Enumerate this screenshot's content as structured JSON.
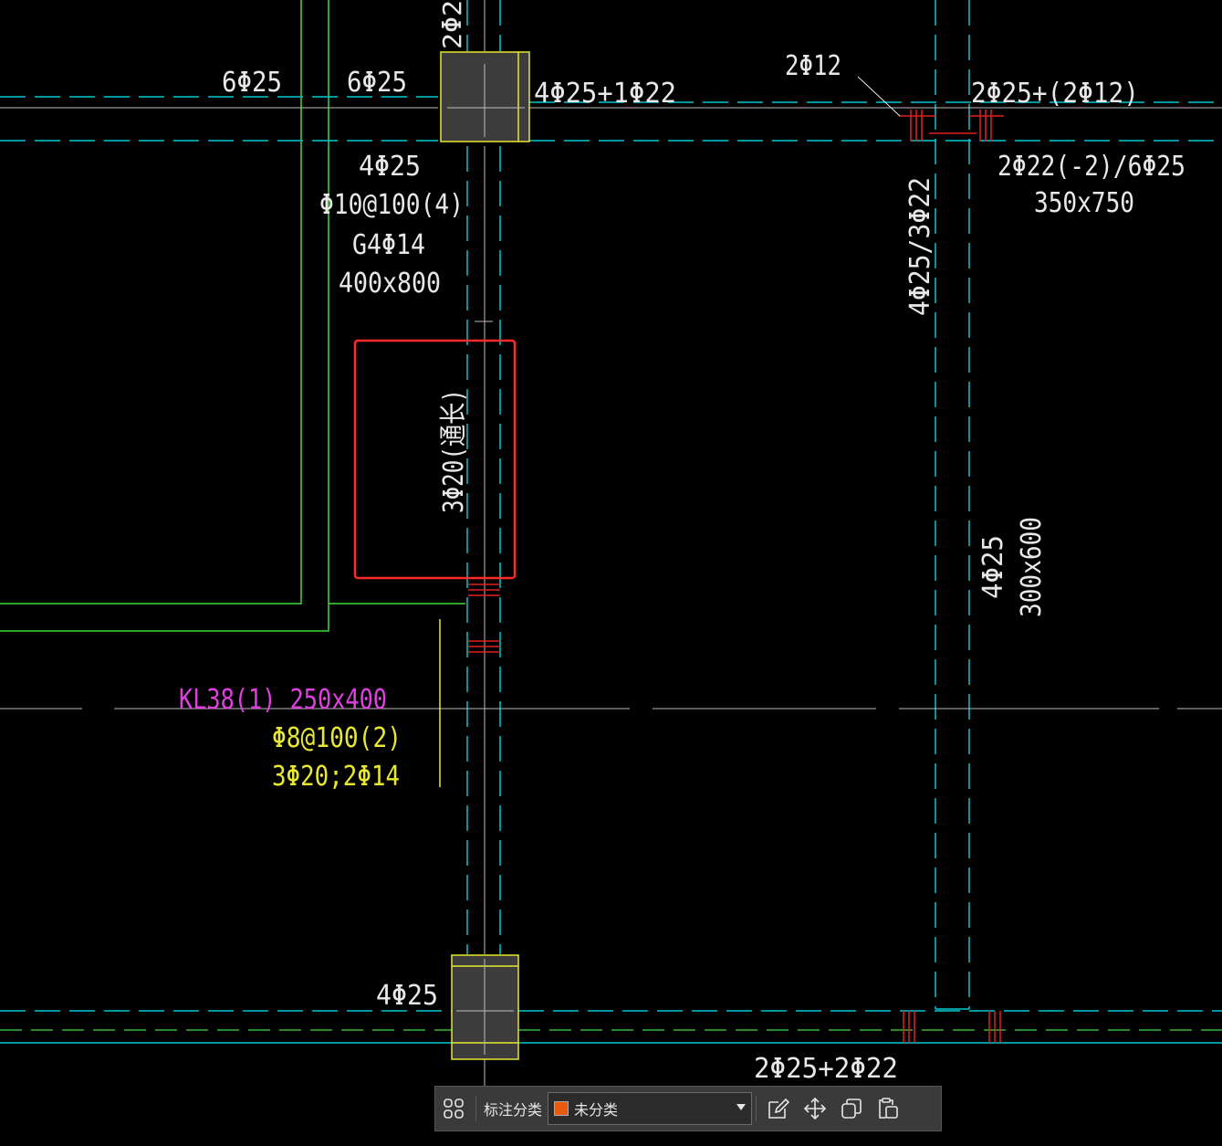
{
  "colors": {
    "axis_cyan": "#00c8d2",
    "wall_green": "#3cdc3c",
    "text_white": "#e8e8e8",
    "beam_magenta": "#e040e0",
    "beam_yellow": "#e8e830",
    "column_fill": "#3c3c3c",
    "column_border": "#e8e830",
    "rebar_red": "#e02020",
    "highlight_red": "#ff2a2a",
    "category_orange": "#e85a10"
  },
  "annotations": {
    "top_cut": "2Φ2",
    "left_6d25": "6Φ25",
    "mid_6d25": "6Φ25",
    "col_top_right": "4Φ25+1Φ22",
    "col_top_below": "4Φ25",
    "stirrup": "Φ10@100(4)",
    "g4": "G4Φ14",
    "section_400": "400x800",
    "tag_2d12": "2Φ12",
    "right_top": "2Φ25+(2Φ12)",
    "right_mid": "2Φ22(-2)/6Φ25",
    "section_350": "350x750",
    "vertical_4d25_3d22": "4Φ25/3Φ22",
    "vertical_tonchang": "3Φ20(通长)",
    "vertical_4d25": "4Φ25",
    "vertical_300x600": "300x600",
    "col_bottom": "4Φ25",
    "bottom_right": "2Φ25+2Φ22"
  },
  "beam_label": {
    "line1": "KL38(1) 250x400",
    "line2": "Φ8@100(2)",
    "line3": "3Φ20;2Φ14"
  },
  "toolbar": {
    "category_label": "标注分类",
    "category_value": "未分类",
    "grid_icon": "grid-icon",
    "edit_icon": "edit-icon",
    "move_icon": "move-icon",
    "copy_icon": "copy-icon",
    "paste_icon": "paste-icon"
  }
}
